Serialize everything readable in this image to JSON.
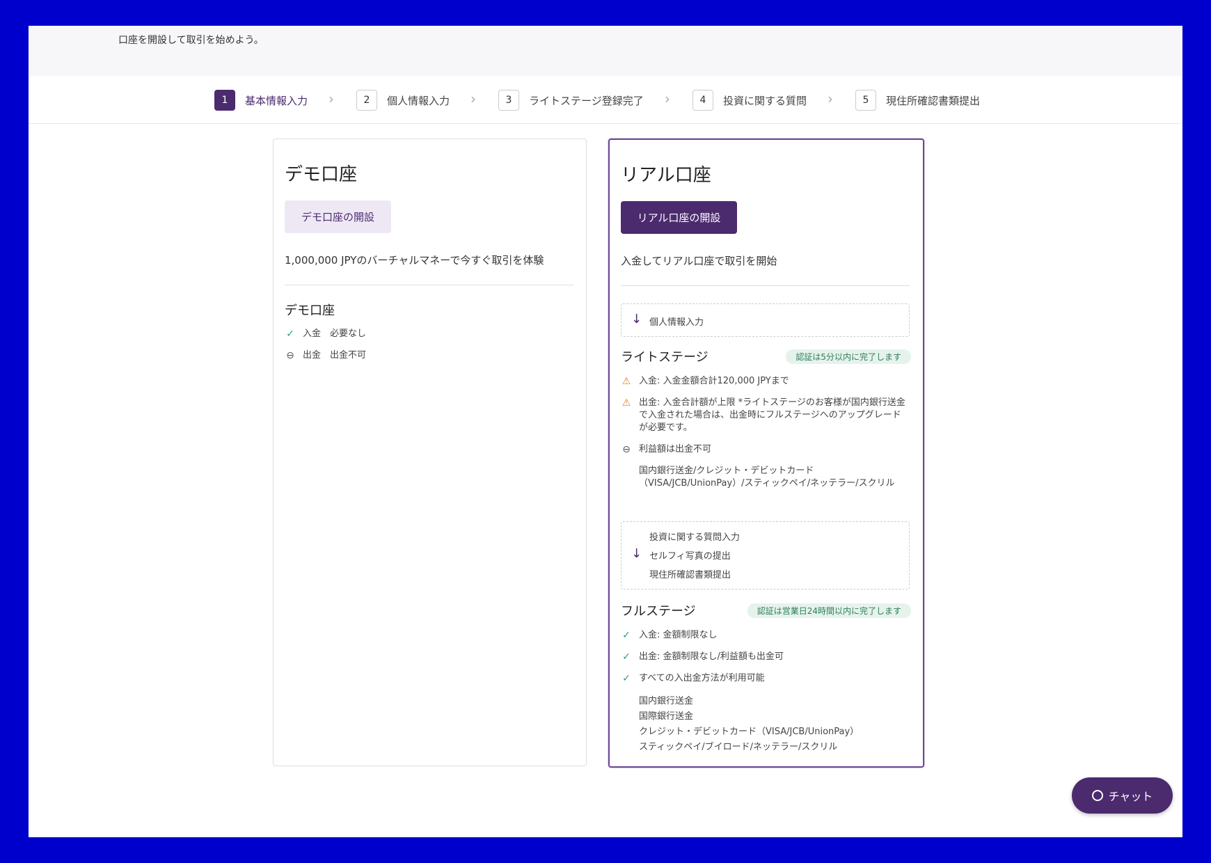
{
  "header": {
    "intro": "口座を開設して取引を始めよう。"
  },
  "steps": [
    {
      "num": "1",
      "label": "基本情報入力"
    },
    {
      "num": "2",
      "label": "個人情報入力"
    },
    {
      "num": "3",
      "label": "ライトステージ登録完了"
    },
    {
      "num": "4",
      "label": "投資に関する質問"
    },
    {
      "num": "5",
      "label": "現住所確認書類提出"
    }
  ],
  "demo": {
    "title": "デモ口座",
    "button": "デモ口座の開設",
    "description": "1,000,000 JPYのバーチャルマネーで今すぐ取引を体験",
    "section_title": "デモ口座",
    "features": [
      "入金　必要なし",
      "出金　出金不可"
    ]
  },
  "real": {
    "title": "リアル口座",
    "button": "リアル口座の開設",
    "description": "入金してリアル口座で取引を開始",
    "step_personal": "個人情報入力",
    "lite": {
      "title": "ライトステージ",
      "badge": "認証は5分以内に完了します",
      "deposit": "入金: 入金金額合計120,000 JPYまで",
      "withdraw": "出金: 入金合計額が上限 *ライトステージのお客様が国内銀行送金で入金された場合は、出金時にフルステージへのアップグレードが必要です。",
      "profit": "利益額は出金不可",
      "methods_line1": "国内銀行送金/クレジット・デビットカード",
      "methods_line2": "（VISA/JCB/UnionPay）/スティックペイ/ネッテラー/スクリル"
    },
    "steps_full": [
      "投資に関する質問入力",
      "セルフィ写真の提出",
      "現住所確認書類提出"
    ],
    "full": {
      "title": "フルステージ",
      "badge": "認証は営業日24時間以内に完了します",
      "features": [
        "入金: 金額制限なし",
        "出金: 金額制限なし/利益額も出金可",
        "すべての入出金方法が利用可能"
      ],
      "methods": [
        "国内銀行送金",
        "国際銀行送金",
        "クレジット・デビットカード（VISA/JCB/UnionPay）",
        "スティックペイ/ブイロード/ネッテラー/スクリル"
      ]
    }
  },
  "chat": {
    "label": "チャット"
  }
}
